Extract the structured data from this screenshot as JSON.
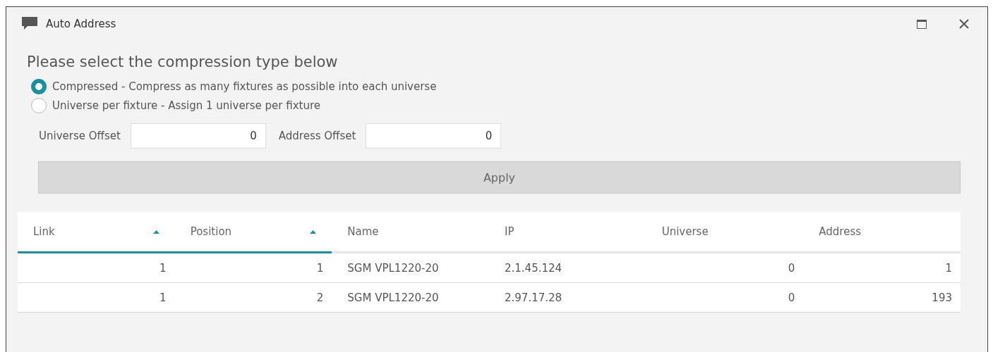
{
  "window": {
    "title": "Auto Address"
  },
  "heading": "Please select the compression type below",
  "options": [
    {
      "label": "Compressed - Compress as many fixtures as possible into each universe",
      "selected": true
    },
    {
      "label": "Universe per fixture - Assign 1 universe per fixture",
      "selected": false
    }
  ],
  "offsets": [
    {
      "label": "Universe Offset",
      "value": "0"
    },
    {
      "label": "Address Offset",
      "value": "0"
    }
  ],
  "apply_button": "Apply",
  "table": {
    "columns": [
      {
        "label": "Link",
        "kind": "number",
        "sorted": true
      },
      {
        "label": "Position",
        "kind": "number",
        "sorted": true
      },
      {
        "label": "Name",
        "kind": "text",
        "sorted": false
      },
      {
        "label": "IP",
        "kind": "text",
        "sorted": false
      },
      {
        "label": "Universe",
        "kind": "number",
        "sorted": false
      },
      {
        "label": "Address",
        "kind": "number",
        "sorted": false
      }
    ],
    "rows": [
      [
        "1",
        "1",
        "SGM VPL1220-20",
        "2.1.45.124",
        "0",
        "1"
      ],
      [
        "1",
        "2",
        "SGM VPL1220-20",
        "2.97.17.28",
        "0",
        "193"
      ]
    ]
  }
}
